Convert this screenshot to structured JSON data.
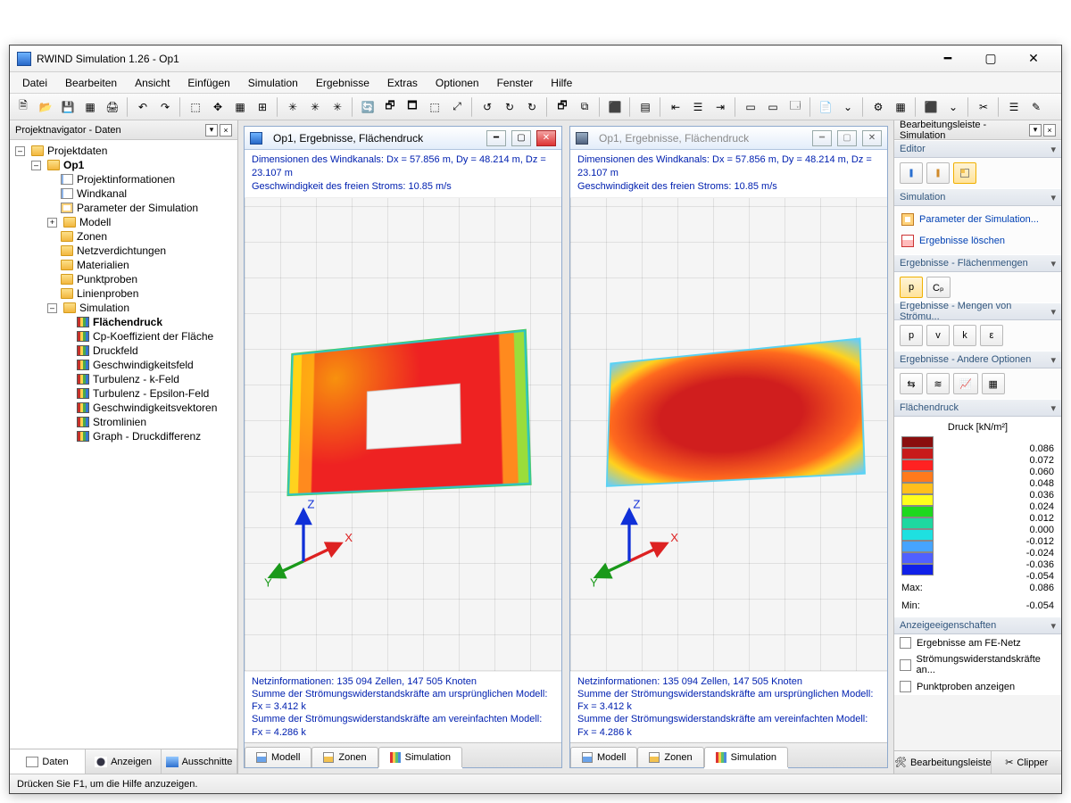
{
  "title": "RWIND Simulation 1.26 - Op1",
  "menu": [
    "Datei",
    "Bearbeiten",
    "Ansicht",
    "Einfügen",
    "Simulation",
    "Ergebnisse",
    "Extras",
    "Optionen",
    "Fenster",
    "Hilfe"
  ],
  "navigator": {
    "title": "Projektnavigator - Daten",
    "root": "Projektdaten",
    "project": "Op1",
    "items_top": [
      "Projektinformationen",
      "Windkanal",
      "Parameter der Simulation"
    ],
    "items_mid_folders": [
      "Modell",
      "Zonen",
      "Netzverdichtungen",
      "Materialien",
      "Punktproben",
      "Linienproben"
    ],
    "simulation_label": "Simulation",
    "simulation_items": [
      "Flächendruck",
      "Cp-Koeffizient der Fläche",
      "Druckfeld",
      "Geschwindigkeitsfeld",
      "Turbulenz - k-Feld",
      "Turbulenz - Epsilon-Feld",
      "Geschwindigkeitsvektoren",
      "Stromlinien",
      "Graph - Druckdifferenz"
    ],
    "tabs": [
      "Daten",
      "Anzeigen",
      "Ausschnitte"
    ]
  },
  "mdi": {
    "win_title": "Op1, Ergebnisse, Flächendruck",
    "info1": "Dimensionen des Windkanals: Dx = 57.856 m, Dy = 48.214 m, Dz = 23.107 m",
    "info2": "Geschwindigkeit des freien Stroms: 10.85 m/s",
    "foot1": "Netzinformationen: 135 094 Zellen, 147 505 Knoten",
    "foot2": "Summe der Strömungswiderstandskräfte am ursprünglichen Modell: Fx = 3.412 k",
    "foot3": "Summe der Strömungswiderstandskräfte am vereinfachten Modell: Fx = 4.286 k",
    "tabs": [
      "Modell",
      "Zonen",
      "Simulation"
    ],
    "axes": {
      "x": "X",
      "y": "Y",
      "z": "Z"
    }
  },
  "right": {
    "title": "Bearbeitungsleiste - Simulation",
    "editor": "Editor",
    "simulation_sec": "Simulation",
    "sim_links": [
      "Parameter der Simulation...",
      "Ergebnisse löschen"
    ],
    "res_surface": "Ergebnisse - Flächenmengen",
    "surface_btns": [
      "p",
      "Cₚ"
    ],
    "res_flow": "Ergebnisse - Mengen von Strömu...",
    "flow_btns": [
      "p",
      "v",
      "k",
      "ε"
    ],
    "res_other": "Ergebnisse - Andere Optionen",
    "pressure_head": "Flächendruck",
    "pressure_title": "Druck [kN/m²]",
    "legend": [
      {
        "c": "#8a0e0e",
        "v": "0.086"
      },
      {
        "c": "#c81a1a",
        "v": "0.072"
      },
      {
        "c": "#ff2222",
        "v": "0.060"
      },
      {
        "c": "#ff7a1c",
        "v": "0.048"
      },
      {
        "c": "#ffbf1c",
        "v": "0.036"
      },
      {
        "c": "#ffff1c",
        "v": "0.024"
      },
      {
        "c": "#1ed81e",
        "v": "0.012"
      },
      {
        "c": "#1ed8a0",
        "v": "0.000"
      },
      {
        "c": "#1ee0e0",
        "v": "-0.012"
      },
      {
        "c": "#46a4ff",
        "v": "-0.024"
      },
      {
        "c": "#5060ff",
        "v": "-0.036"
      },
      {
        "c": "#1020e8",
        "v": "-0.054"
      }
    ],
    "max_label": "Max:",
    "max_val": "0.086",
    "min_label": "Min:",
    "min_val": "-0.054",
    "display_head": "Anzeigeeigenschaften",
    "checks": [
      "Ergebnisse am FE-Netz",
      "Strömungswiderstandskräfte an...",
      "Punktproben anzeigen"
    ],
    "tabs": [
      "Bearbeitungsleiste",
      "Clipper"
    ]
  },
  "status": "Drücken Sie F1, um die Hilfe anzuzeigen."
}
